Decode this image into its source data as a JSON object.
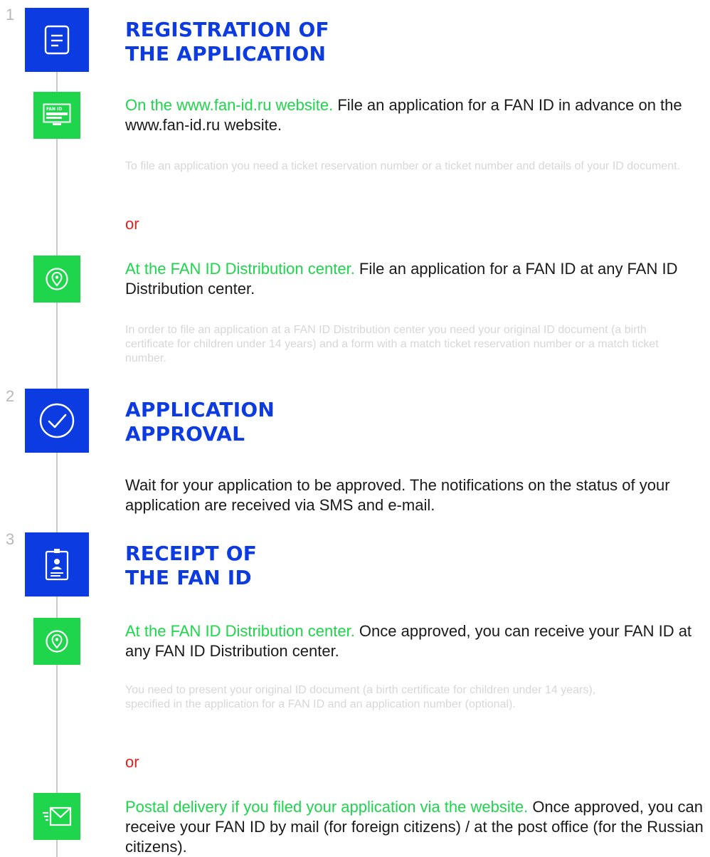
{
  "colors": {
    "brand_blue": "#0d3be2",
    "accent_green": "#1ed54c",
    "or_red": "#e4201f",
    "note_gray": "#d7d7d7",
    "line_gray": "#c9c9c9"
  },
  "steps": [
    {
      "number": "1",
      "icon": "document-icon",
      "title_line1": "REGISTRATION OF",
      "title_line2": "THE APPLICATION",
      "options": [
        {
          "icon": "fan-id-monitor-icon",
          "icon_label": "FAN ID",
          "highlight": "On the www.fan-id.ru website.",
          "text": " File an application for a FAN ID in advance on the www.fan-id.ru website.",
          "note": "To file an application you need a ticket reservation number or a ticket number and details of your ID document."
        },
        {
          "icon": "location-pin-icon",
          "highlight": "At the FAN ID Distribution center.",
          "text": " File an application for a FAN ID at any FAN ID Distribution center.",
          "note": "In order to file an application at a FAN ID Distribution center you need your original ID document (a birth certificate for children under 14 years) and a form with a match ticket reservation number or a match ticket number."
        }
      ],
      "separator": "or"
    },
    {
      "number": "2",
      "icon": "checkmark-circle-icon",
      "title_line1": "APPLICATION",
      "title_line2": "APPROVAL",
      "text": "Wait for your application to be approved. The notifications on the status of your application are received via SMS and e-mail."
    },
    {
      "number": "3",
      "icon": "id-badge-icon",
      "title_line1": "RECEIPT OF",
      "title_line2": "THE FAN ID",
      "options": [
        {
          "icon": "location-pin-icon",
          "highlight": "At the FAN ID Distribution center.",
          "text": " Once approved, you can receive your FAN ID at any FAN ID Distribution center.",
          "note": "You need to present your original ID document (a birth certificate for children under 14 years), specified in the application for a FAN ID and an application number (optional)."
        },
        {
          "icon": "mail-delivery-icon",
          "highlight": "Postal delivery if you filed your application via the website.",
          "text": " Once approved, you can receive your FAN ID by mail (for foreign citizens) / at the post office (for the Russian citizens)."
        }
      ],
      "separator": "or"
    }
  ]
}
